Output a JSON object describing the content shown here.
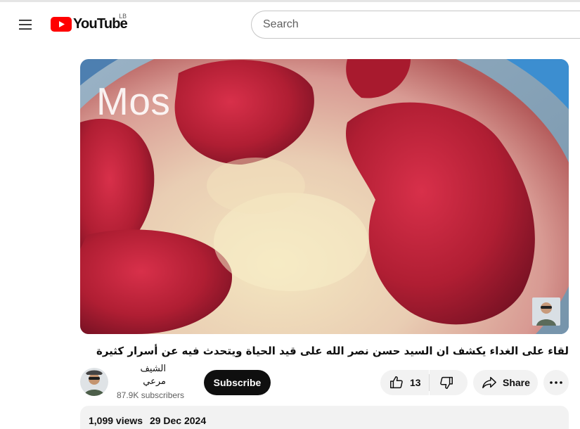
{
  "header": {
    "menu_icon": "hamburger-menu-icon",
    "logo_text": "YouTube",
    "country_code": "LB",
    "search": {
      "placeholder": "Search",
      "value": ""
    },
    "colors": {
      "brand_red": "#ff0000"
    }
  },
  "video": {
    "overlay_text": "Mos",
    "title": "لقاء على الغداء يكشف ان السيد حسن نصر الله على قيد الحياة ويتحدث فيه عن أسرار كثيرة"
  },
  "owner": {
    "channel_name": "الشيف مرعي",
    "subscribers": "87.9K subscribers",
    "subscribe_label": "Subscribe"
  },
  "actions": {
    "like_count": "13",
    "share_label": "Share",
    "icons": [
      "like-icon",
      "dislike-icon",
      "share-icon",
      "more-icon"
    ]
  },
  "description": {
    "views": "1,099 views",
    "date": "29 Dec 2024"
  }
}
